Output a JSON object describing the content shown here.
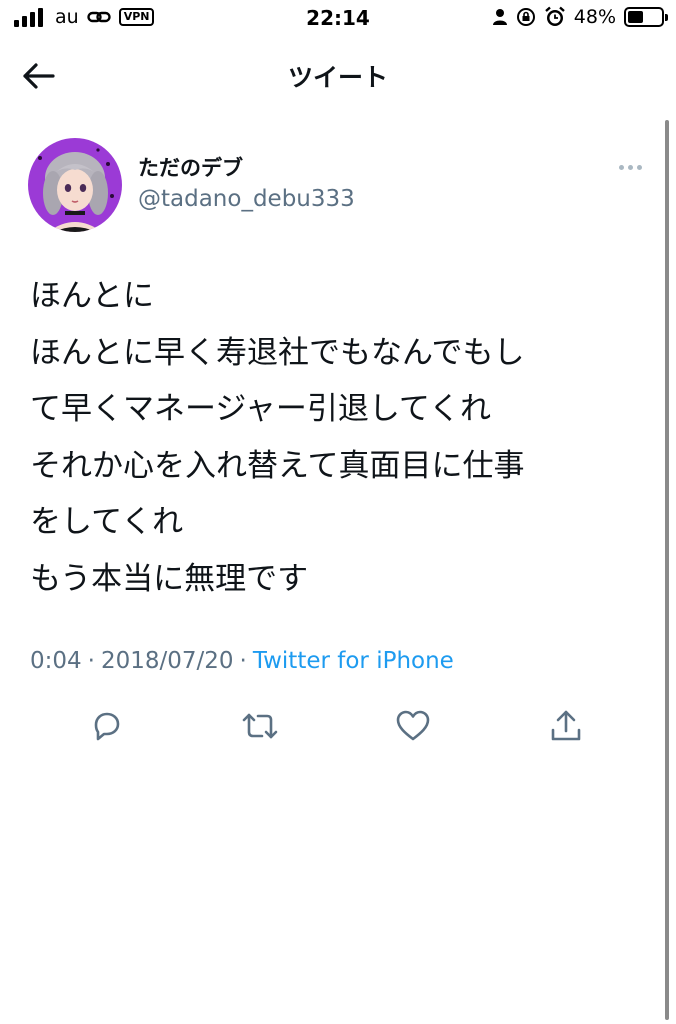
{
  "status_bar": {
    "carrier": "au",
    "vpn_label": "VPN",
    "time": "22:14",
    "battery_percent": "48%",
    "battery_level": 0.48,
    "signal_bars": 4
  },
  "nav": {
    "back_icon": "arrow-left-icon",
    "title": "ツイート"
  },
  "tweet": {
    "author": {
      "display_name": "ただのデブ",
      "handle": "@tadano_debu333"
    },
    "text_lines": [
      "ほんとに",
      "ほんとに早く寿退社でもなんでもし",
      "て早くマネージャー引退してくれ",
      "それか心を入れ替えて真面目に仕事",
      "をしてくれ",
      "もう本当に無理です"
    ],
    "meta": {
      "time": "0:04",
      "separator": "·",
      "date": "2018/07/20",
      "source": "Twitter for iPhone"
    },
    "actions": {
      "reply_icon": "reply-icon",
      "retweet_icon": "retweet-icon",
      "like_icon": "heart-icon",
      "share_icon": "share-icon"
    }
  },
  "colors": {
    "text_primary": "#0f1419",
    "text_secondary": "#5b7083",
    "link": "#1d9bf0",
    "avatar_bg": "#9b3ad6"
  }
}
